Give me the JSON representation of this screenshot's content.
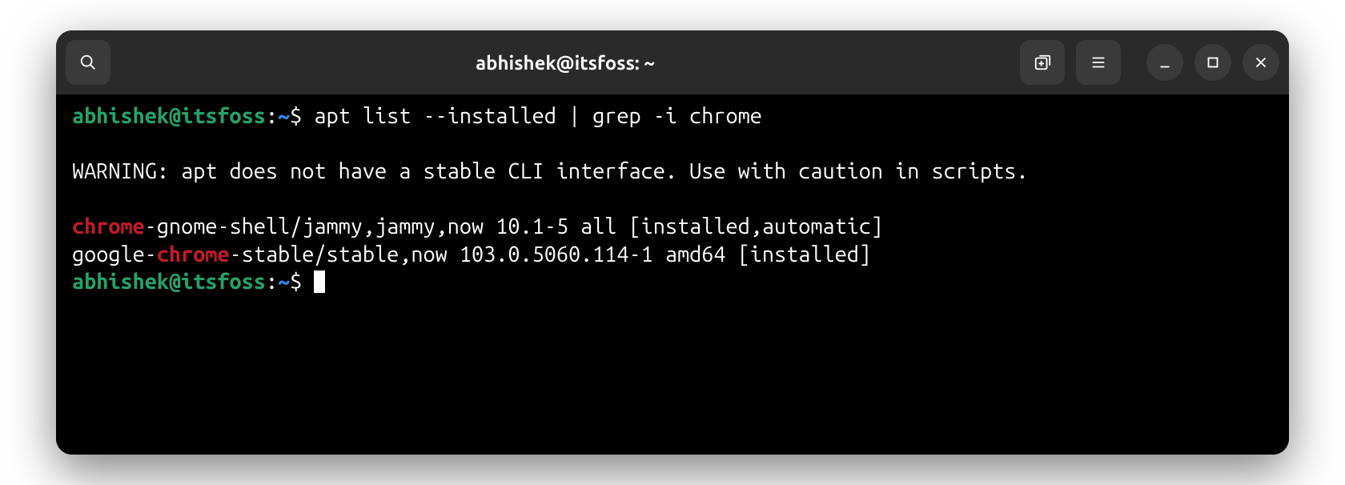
{
  "titlebar": {
    "title": "abhishek@itsfoss: ~"
  },
  "prompt": {
    "user_host": "abhishek@itsfoss",
    "colon": ":",
    "path": "~",
    "dollar": "$ "
  },
  "terminal": {
    "command": "apt list --installed | grep -i chrome",
    "blank1": "",
    "warning": "WARNING: apt does not have a stable CLI interface. Use with caution in scripts.",
    "blank2": "",
    "line1": {
      "hl1": "chrome",
      "rest1": "-gnome-shell/jammy,jammy,now 10.1-5 all [installed,automatic]"
    },
    "line2": {
      "pre": "google-",
      "hl": "chrome",
      "rest": "-stable/stable,now 103.0.5060.114-1 amd64 [installed]"
    }
  }
}
